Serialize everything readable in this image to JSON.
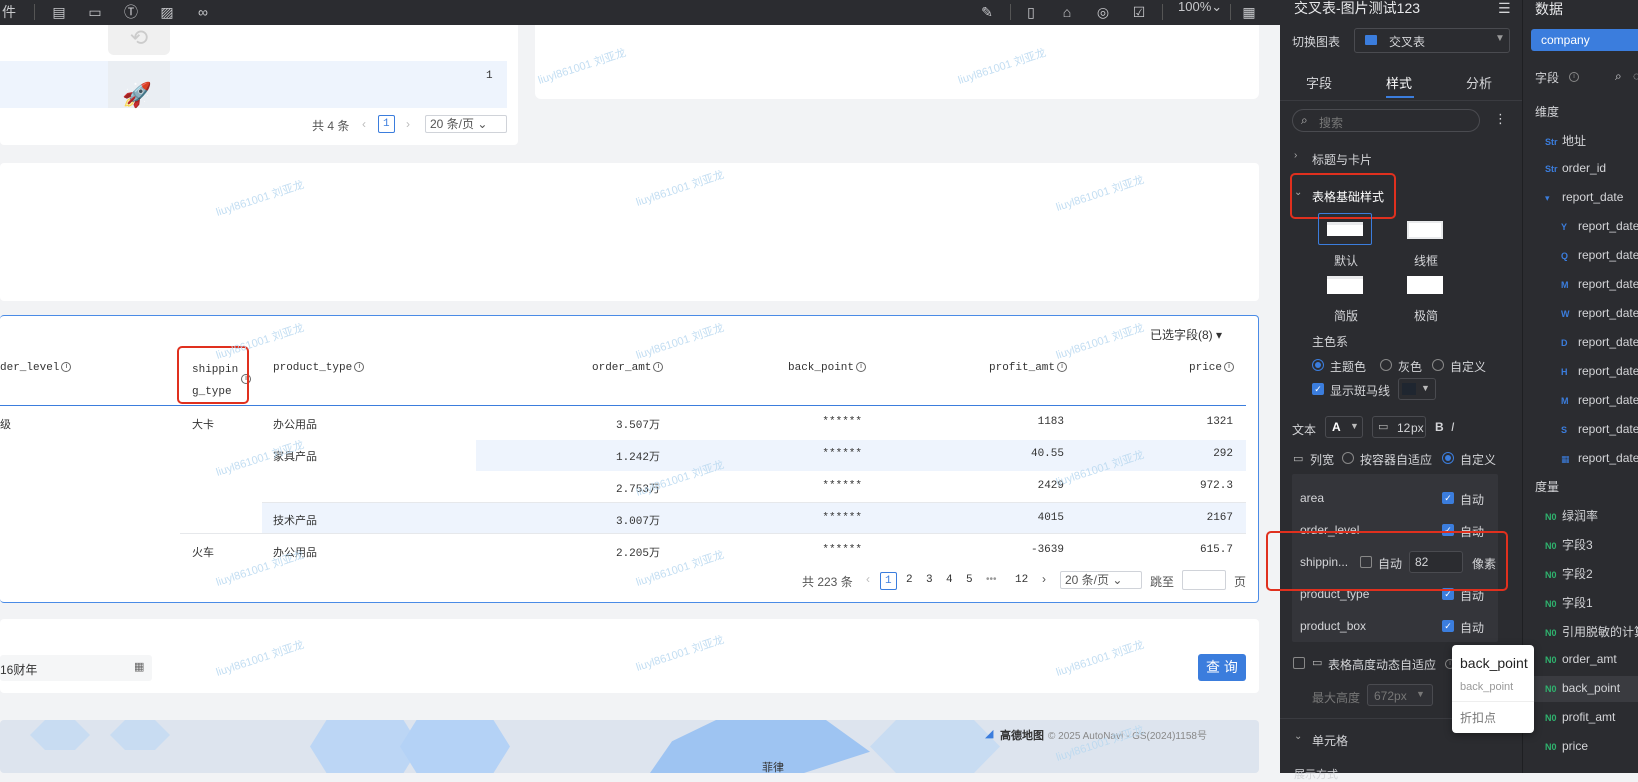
{
  "toolbar": {
    "zoom": "100%",
    "zoom_arrow": "⌄"
  },
  "canvas": {
    "top_table": {
      "row_value": "1",
      "total": "共 4 条",
      "page": "1",
      "page_size": "20 条/页"
    },
    "watermark": "liuyl861001 刘亚龙",
    "main_table": {
      "selected_fields": "已选字段(8)",
      "headers": [
        "der_level",
        "shippin",
        "g_type",
        "product_type",
        "order_amt",
        "back_point",
        "profit_amt",
        "price"
      ],
      "rows": [
        {
          "level": "级",
          "ship": "大卡",
          "ptype": "办公用品",
          "amt": "3.507万",
          "bp": "******",
          "profit": "1183",
          "price": "1321"
        },
        {
          "level": "",
          "ship": "",
          "ptype": "家具产品",
          "amt": "1.242万",
          "bp": "******",
          "profit": "40.55",
          "price": "292"
        },
        {
          "level": "",
          "ship": "",
          "ptype": "",
          "amt": "2.753万",
          "bp": "******",
          "profit": "2429",
          "price": "972.3"
        },
        {
          "level": "",
          "ship": "",
          "ptype": "技术产品",
          "amt": "3.007万",
          "bp": "******",
          "profit": "4015",
          "price": "2167"
        },
        {
          "level": "",
          "ship": "火车",
          "ptype": "办公用品",
          "amt": "2.205万",
          "bp": "******",
          "profit": "-3639",
          "price": "615.7"
        }
      ],
      "pager": {
        "total": "共 223 条",
        "pages": [
          "1",
          "2",
          "3",
          "4",
          "5",
          "•••",
          "12"
        ],
        "page_size": "20 条/页",
        "jump": "跳至",
        "page_unit": "页"
      }
    },
    "filter": {
      "date_value": "16财年",
      "query_button": "查 询"
    },
    "map": {
      "logo": "高德地图",
      "copyright": "© 2025 AutoNavi - GS(2024)1158号",
      "place": "菲律"
    }
  },
  "style_panel": {
    "title": "交叉表-图片测试123",
    "switch_chart_label": "切换图表",
    "chart_type": "交叉表",
    "tabs": [
      "字段",
      "样式",
      "分析"
    ],
    "active_tab": "样式",
    "search_placeholder": "搜索",
    "sections": {
      "title_card": "标题与卡片",
      "table_base": "表格基础样式",
      "cell": "单元格",
      "display_mode": "展示方式"
    },
    "layouts": [
      "默认",
      "线框",
      "简版",
      "极简"
    ],
    "theme_label": "主色系",
    "theme_options": [
      "主题色",
      "灰色",
      "自定义"
    ],
    "zebra_label": "显示斑马线",
    "text_label": "文本",
    "font_size": "12",
    "font_unit": "px",
    "bold": "B",
    "italic": "I",
    "col_width_label": "列宽",
    "col_width_options": [
      "按容器自适应",
      "自定义"
    ],
    "col_rows": [
      {
        "name": "area",
        "auto_label": "自动",
        "checked": true
      },
      {
        "name": "order_level",
        "auto_label": "自动",
        "checked": true
      },
      {
        "name": "shippin...",
        "auto_label": "自动",
        "checked": false,
        "value": "82",
        "unit": "像素"
      },
      {
        "name": "product_type",
        "auto_label": "自动",
        "checked": true
      },
      {
        "name": "product_box",
        "auto_label": "自动",
        "checked": true
      }
    ],
    "dynamic_height": "表格高度动态自适应",
    "max_height_label": "最大高度",
    "max_height_value": "672px"
  },
  "tooltip": {
    "title": "back_point",
    "subtitle": "back_point",
    "desc": "折扣点"
  },
  "data_panel": {
    "title": "数据",
    "dataset": "company",
    "fields_label": "字段",
    "dimension_label": "维度",
    "dimensions": [
      {
        "icon": "Str",
        "name": "地址",
        "indent": false
      },
      {
        "icon": "Str",
        "name": "order_id",
        "indent": false
      },
      {
        "icon": "▾",
        "name": "report_date",
        "indent": false
      },
      {
        "icon": "Y",
        "name": "report_date",
        "indent": true
      },
      {
        "icon": "Q",
        "name": "report_date",
        "indent": true
      },
      {
        "icon": "M",
        "name": "report_date",
        "indent": true
      },
      {
        "icon": "W",
        "name": "report_date",
        "indent": true
      },
      {
        "icon": "D",
        "name": "report_date",
        "indent": true
      },
      {
        "icon": "H",
        "name": "report_date",
        "indent": true
      },
      {
        "icon": "M",
        "name": "report_date",
        "indent": true
      },
      {
        "icon": "S",
        "name": "report_date",
        "indent": true
      },
      {
        "icon": "▦",
        "name": "report_date",
        "indent": true
      }
    ],
    "measure_label": "度量",
    "measures": [
      "绿润率",
      "字段3",
      "字段2",
      "字段1",
      "引用脱敏的计算",
      "order_amt",
      "back_point",
      "profit_amt",
      "price"
    ]
  }
}
